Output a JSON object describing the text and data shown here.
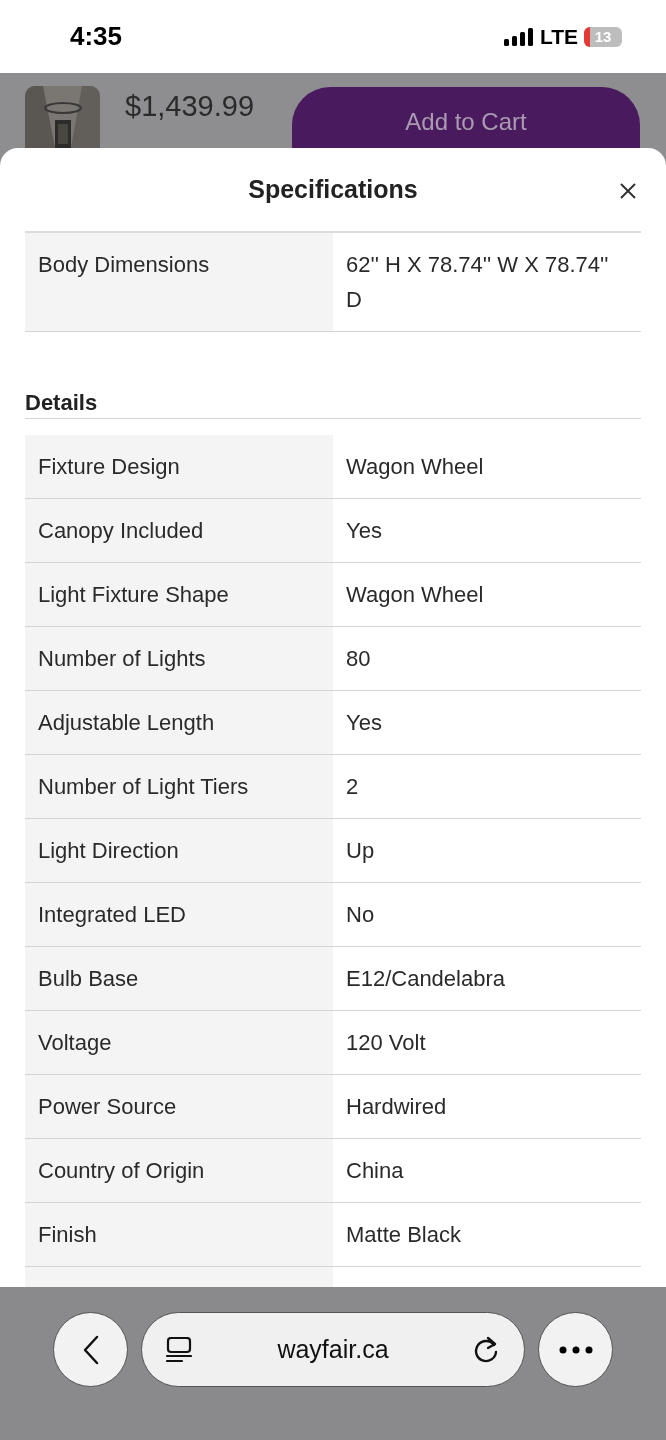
{
  "status_bar": {
    "time": "4:35",
    "network": "LTE",
    "battery": "13"
  },
  "product_bar": {
    "price": "$1,439.99",
    "button": "Add to Cart"
  },
  "sheet": {
    "title": "Specifications",
    "top_rows": [
      {
        "label": "Body Dimensions",
        "value": "62'' H X 78.74'' W X 78.74'' D"
      }
    ],
    "details": {
      "heading": "Details",
      "rows": [
        {
          "label": "Fixture Design",
          "value": "Wagon Wheel"
        },
        {
          "label": "Canopy Included",
          "value": "Yes"
        },
        {
          "label": "Light Fixture Shape",
          "value": "Wagon Wheel"
        },
        {
          "label": "Number of Lights",
          "value": "80"
        },
        {
          "label": "Adjustable Length",
          "value": "Yes"
        },
        {
          "label": "Number of Light Tiers",
          "value": "2"
        },
        {
          "label": "Light Direction",
          "value": "Up"
        },
        {
          "label": "Integrated LED",
          "value": "No"
        },
        {
          "label": "Bulb Base",
          "value": "E12/Candelabra"
        },
        {
          "label": "Voltage",
          "value": "120 Volt"
        },
        {
          "label": "Power Source",
          "value": "Hardwired"
        },
        {
          "label": "Country of Origin",
          "value": "China"
        },
        {
          "label": "Finish",
          "value": "Matte Black"
        }
      ]
    }
  },
  "browser": {
    "url": "wayfair.ca"
  }
}
